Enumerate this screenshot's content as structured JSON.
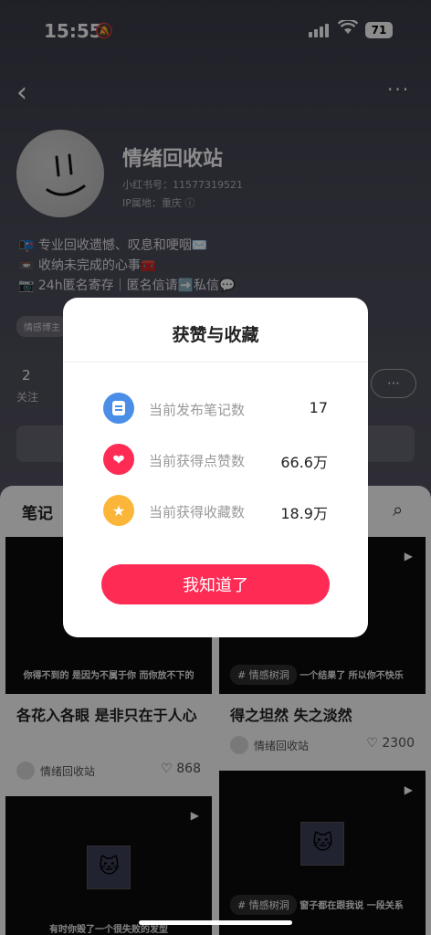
{
  "status_bar": {
    "time": "15:55",
    "battery": "71"
  },
  "profile": {
    "name": "情绪回收站",
    "id_label": "小红书号：11577319521",
    "ip_label": "IP属地：重庆",
    "bio": [
      "📭 专业回收遗憾、叹息和哽咽✉️",
      "📼 收纳未完成的心事🧰",
      "📷 24h匿名寄存｜匿名信请➡️私信💬"
    ],
    "tag": "情感博主",
    "follow_count": "2",
    "follow_label": "关注"
  },
  "feed": {
    "tab_label": "笔记",
    "cards": [
      {
        "overlay": "你得不到的 是因为不属于你 而你放不下的",
        "title": "各花入各眼 是非只在于人心",
        "author": "情绪回收站",
        "likes": "868"
      },
      {
        "overlay": "一个结果了 所以你不快乐",
        "hashtag": "# 情感树洞",
        "title": "得之坦然 失之淡然",
        "author": "情绪回收站",
        "likes": "2300"
      },
      {
        "overlay": "有时你毁了一个很失败的发型"
      },
      {
        "overlay": "窗子都在跟我说 一段关系",
        "hashtag": "# 情感树洞"
      }
    ]
  },
  "modal": {
    "title": "获赞与收藏",
    "stats": [
      {
        "icon": "note-icon",
        "label": "当前发布笔记数",
        "value": "17",
        "color": "#4a8ee8"
      },
      {
        "icon": "heart-icon",
        "label": "当前获得点赞数",
        "value": "66.6万",
        "color": "#fe2c55"
      },
      {
        "icon": "star-icon",
        "label": "当前获得收藏数",
        "value": "18.9万",
        "color": "#fbb63a"
      }
    ],
    "confirm_label": "我知道了"
  },
  "colors": {
    "accent": "#fe2c55"
  }
}
